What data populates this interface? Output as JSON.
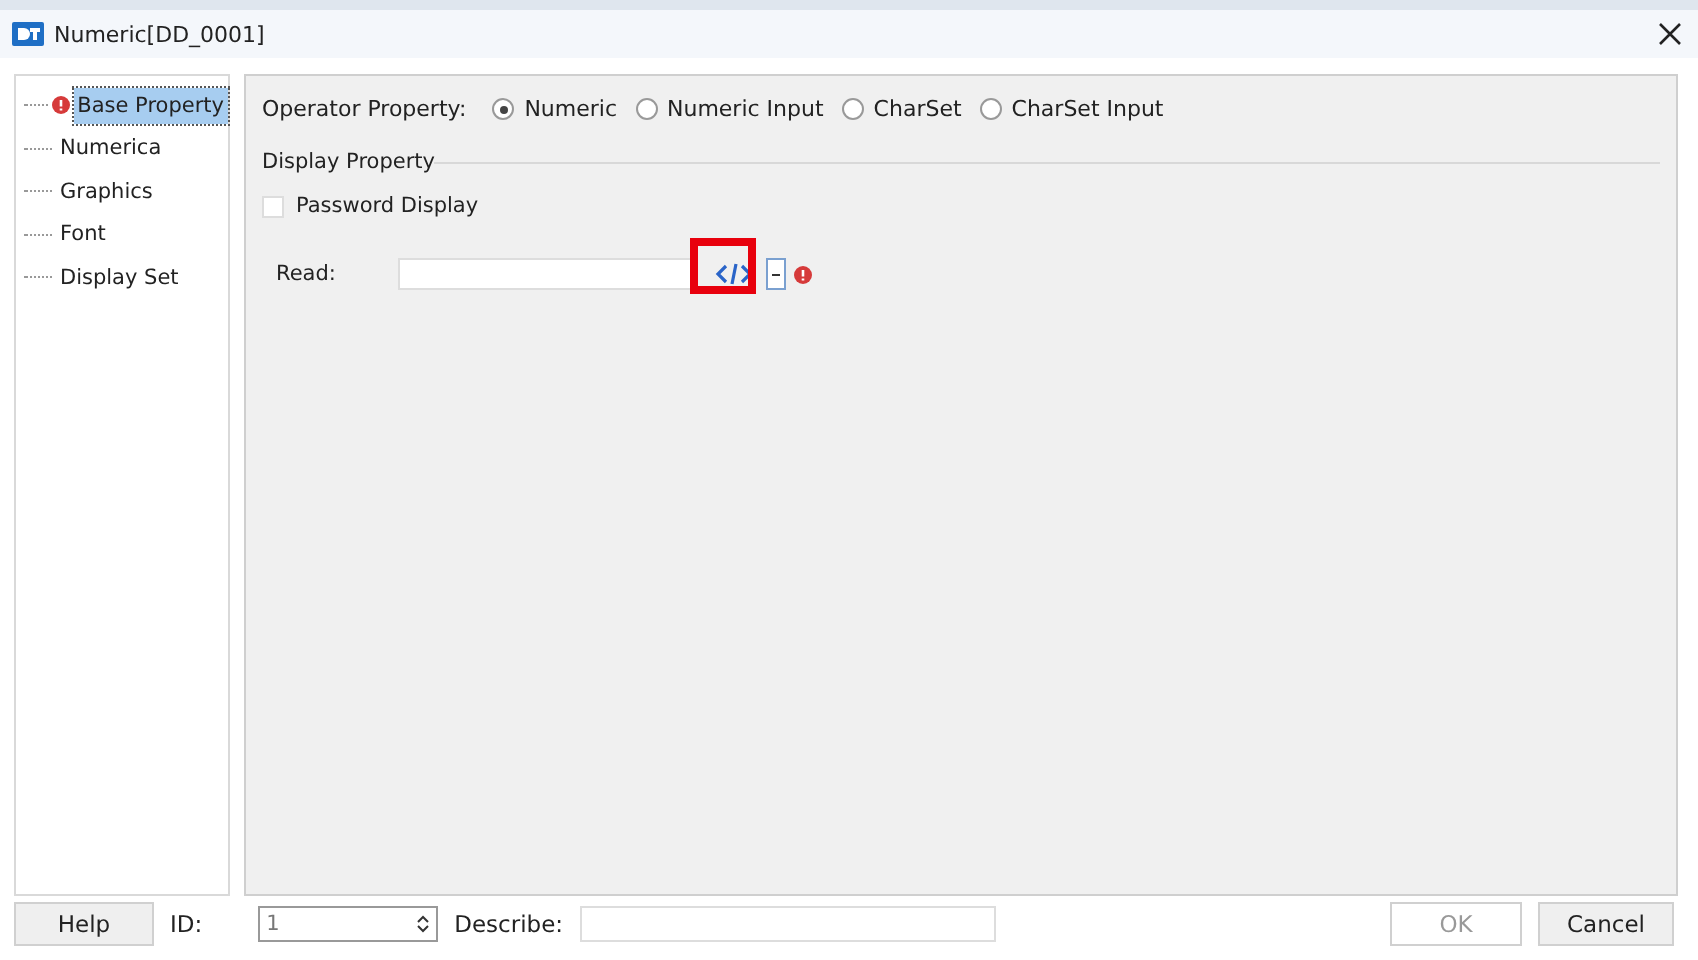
{
  "window": {
    "title": "Numeric[DD_0001]"
  },
  "tree": {
    "items": [
      {
        "label": "Base Property",
        "selected": true,
        "warning": true
      },
      {
        "label": "Numerica",
        "selected": false,
        "warning": false
      },
      {
        "label": "Graphics",
        "selected": false,
        "warning": false
      },
      {
        "label": "Font",
        "selected": false,
        "warning": false
      },
      {
        "label": "Display Set",
        "selected": false,
        "warning": false
      }
    ]
  },
  "operator_property": {
    "label": "Operator Property:",
    "options": [
      {
        "label": "Numeric",
        "selected": true
      },
      {
        "label": "Numeric Input",
        "selected": false
      },
      {
        "label": "CharSet",
        "selected": false
      },
      {
        "label": "CharSet Input",
        "selected": false
      }
    ]
  },
  "display_property": {
    "title": "Display Property",
    "password_display": {
      "label": "Password Display",
      "checked": false
    }
  },
  "read": {
    "label": "Read:",
    "warning": true,
    "code_button_highlighted": true
  },
  "footer": {
    "help": "Help",
    "id_label": "ID:",
    "id_value": "1",
    "describe_label": "Describe:",
    "ok": {
      "label": "OK",
      "disabled": true
    },
    "cancel": "Cancel"
  }
}
